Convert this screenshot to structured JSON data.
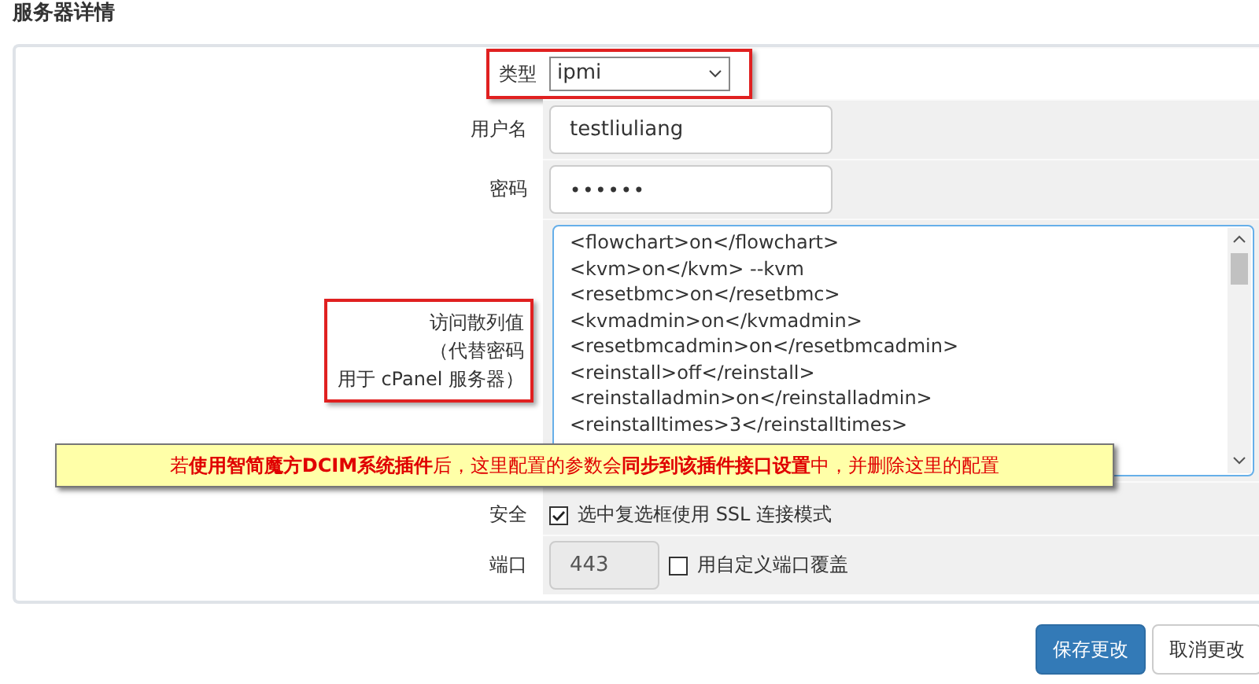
{
  "section_title": "服务器详情",
  "fields": [
    {
      "kind": "select",
      "label": "类型",
      "value": "ipmi",
      "highlighted": true
    },
    {
      "kind": "text",
      "label": "用户名",
      "value": "testliuliang"
    },
    {
      "kind": "password",
      "label": "密码",
      "value": "••••••"
    },
    {
      "kind": "textarea",
      "label_lines": [
        "访问散列值",
        "（代替密码",
        "用于 cPanel 服务器）"
      ],
      "highlighted": true,
      "lines": [
        "<flowchart>on</flowchart>",
        "<kvm>on</kvm>  --kvm",
        "<resetbmc>on</resetbmc>",
        "<kvmadmin>on</kvmadmin>",
        "<resetbmcadmin>on</resetbmcadmin>",
        "<reinstall>off</reinstall>",
        "<reinstalladmin>on</reinstalladmin>",
        "<reinstalltimes>3</reinstalltimes>"
      ]
    },
    {
      "kind": "checkbox",
      "label": "安全",
      "checked": true,
      "text": "选中复选框使用 SSL 连接模式"
    },
    {
      "kind": "port",
      "label": "端口",
      "value": "443",
      "disabled": true,
      "checked": false,
      "text": "用自定义端口覆盖"
    }
  ],
  "callout": "若**使用智简魔方DCIM系统插件**后，这里配置的参数会**同步到该插件接口设置**中，并删除这里的配置",
  "buttons": [
    {
      "label": "保存更改",
      "primary": true
    },
    {
      "label": "取消更改",
      "primary": false
    }
  ]
}
